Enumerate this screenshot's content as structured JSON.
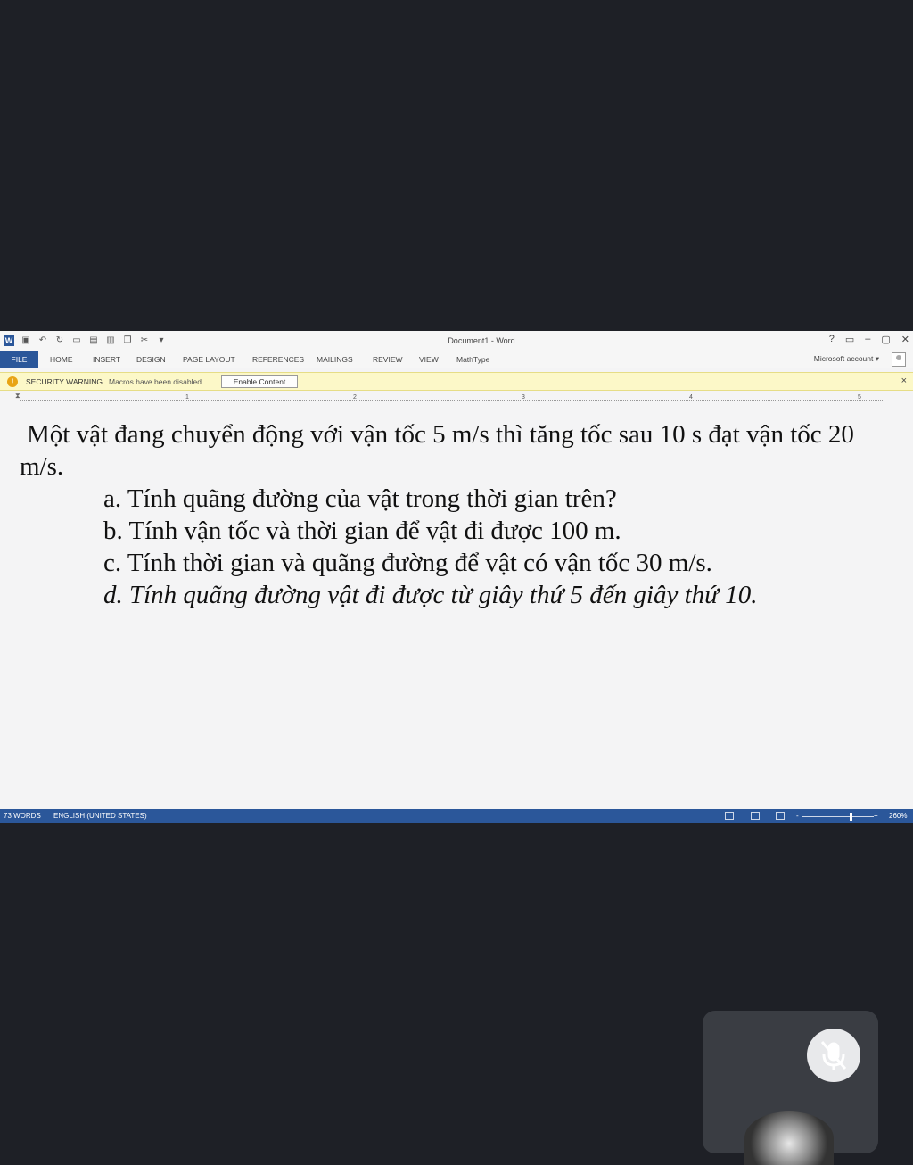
{
  "title_bar": {
    "doc_title": "Document1 - Word",
    "qat_icons": [
      "word-logo",
      "save-icon",
      "undo-icon",
      "redo-icon",
      "open-icon",
      "save-as-icon",
      "paste-icon",
      "copy-icon",
      "cut-icon",
      "customize-icon"
    ],
    "window_controls": {
      "help": "?",
      "ribbon_options": "▭",
      "minimize": "–",
      "restore": "▢",
      "close": "✕"
    }
  },
  "ribbon": {
    "tabs": [
      "FILE",
      "HOME",
      "INSERT",
      "DESIGN",
      "PAGE LAYOUT",
      "REFERENCES",
      "MAILINGS",
      "REVIEW",
      "VIEW",
      "MathType"
    ],
    "account": "Microsoft account ▾"
  },
  "security_bar": {
    "title": "SECURITY WARNING",
    "message": "Macros have been disabled.",
    "button": "Enable Content",
    "close": "×",
    "warn_glyph": "!"
  },
  "ruler": {
    "numbers": [
      "1",
      "2",
      "3",
      "4",
      "5"
    ]
  },
  "document": {
    "intro": "Một vật đang chuyển động với vận tốc 5 m/s thì tăng tốc sau 10 s đạt vận tốc 20 m/s.",
    "items": [
      "a. Tính quãng đường của vật trong thời gian trên?",
      "b. Tính vận tốc và thời gian để vật đi được 100 m.",
      "c. Tính thời gian và quãng đường để vật có vận tốc 30 m/s.",
      "d. Tính quãng đường vật đi được từ giây thứ 5 đến giây thứ 10."
    ]
  },
  "status_bar": {
    "word_count": "73 WORDS",
    "language": "ENGLISH (UNITED STATES)",
    "zoom": "260%",
    "zoom_minus": "-",
    "zoom_plus": "+"
  },
  "colors": {
    "accent": "#2b579a",
    "warning_bg": "#fcf8c8",
    "desktop_bg": "#1e2026"
  }
}
